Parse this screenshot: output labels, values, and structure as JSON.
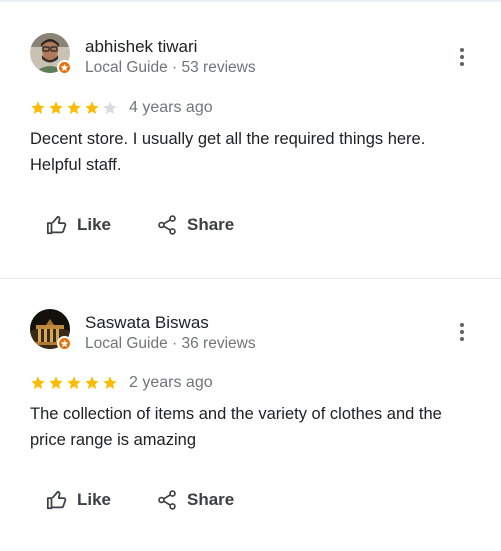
{
  "reviews": [
    {
      "author": "abhishek tiwari",
      "meta": "Local Guide · 53 reviews",
      "rating": 4,
      "max_rating": 5,
      "time": "4 years ago",
      "text": "Decent store. I usually get all the required things here. Helpful staff.",
      "like_label": "Like",
      "share_label": "Share"
    },
    {
      "author": "Saswata Biswas",
      "meta": "Local Guide · 36 reviews",
      "rating": 5,
      "max_rating": 5,
      "time": "2 years ago",
      "text": "The collection of items and the variety of clothes and the price range is amazing",
      "like_label": "Like",
      "share_label": "Share"
    }
  ],
  "colors": {
    "star_filled": "#fbbc04",
    "star_empty": "#dadce0",
    "guide_badge": "#e8710a",
    "meta_text": "#70757a"
  },
  "icons": {
    "more": "more-vert-icon",
    "like": "thumb-up-icon",
    "share": "share-icon",
    "badge": "local-guide-star-icon"
  }
}
